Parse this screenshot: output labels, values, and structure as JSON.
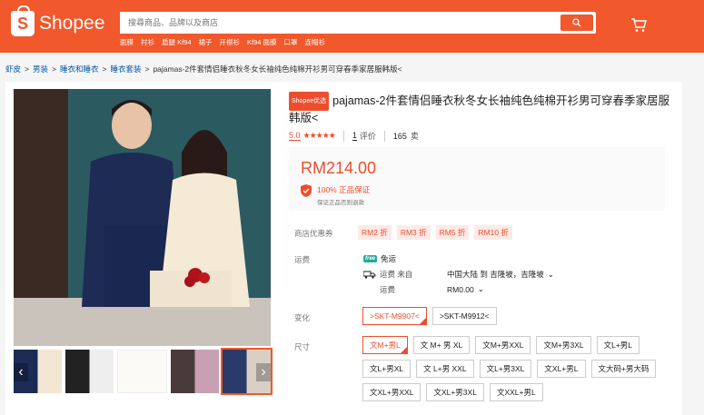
{
  "header": {
    "logo_text": "Shopee",
    "search_placeholder": "搜尋商品、品牌以及商店",
    "hot_keywords": [
      "面膜",
      "衬衫",
      "盾腿 Kf94",
      "裙子",
      "开襟衫",
      "Kf94 面膜",
      "口罩",
      "连帽衫"
    ],
    "accent_color": "#f1582c"
  },
  "breadcrumb": {
    "items": [
      "虾皮",
      "男装",
      "睡衣和睡衣",
      "睡衣套装"
    ],
    "current": "pajamas-2件套情侣睡衣秋冬女长袖纯色纯棉开衫男可穿春季家居服韩版<"
  },
  "product": {
    "badge": "Shopee优选",
    "title": "pajamas-2件套情侣睡衣秋冬女长袖纯色纯棉开衫男可穿春季家居服韩版<",
    "rating_value": "5.0",
    "stars": "★★★★★",
    "rating_count": "1",
    "rating_label": "评价",
    "sold_count": "165",
    "sold_label": "卖",
    "price": "RM214.00",
    "guarantee_title": "100% 正品保证",
    "guarantee_sub": "保证正品否则退款"
  },
  "details": {
    "voucher_label": "商店优惠券",
    "vouchers": [
      "RM2 折",
      "RM3 折",
      "RM5 折",
      "RM10 折"
    ],
    "shipping_label": "运费",
    "free_shipping": "免运",
    "free_icon": "free",
    "ship_from_label": "运费 来自",
    "ship_from_value": "中国大陆 到 吉隆坡，吉隆坡",
    "ship_fee_label": "运费",
    "ship_fee_value": "RM0.00",
    "variation_label": "变化",
    "variations": [
      ">SKT-M9907<",
      ">SKT-M9912<"
    ],
    "size_label": "尺寸",
    "sizes": [
      "文M+男L",
      "文 M+ 男 XL",
      "文M+男XXL",
      "文M+男3XL",
      "文L+男L",
      "文L+男XL",
      "文 L+男 XXL",
      "文L+男3XL",
      "文XL+男L",
      "文大码+男大码",
      "文XL+男XXL",
      "文XL+男3XL",
      "文XXL+男L"
    ]
  }
}
